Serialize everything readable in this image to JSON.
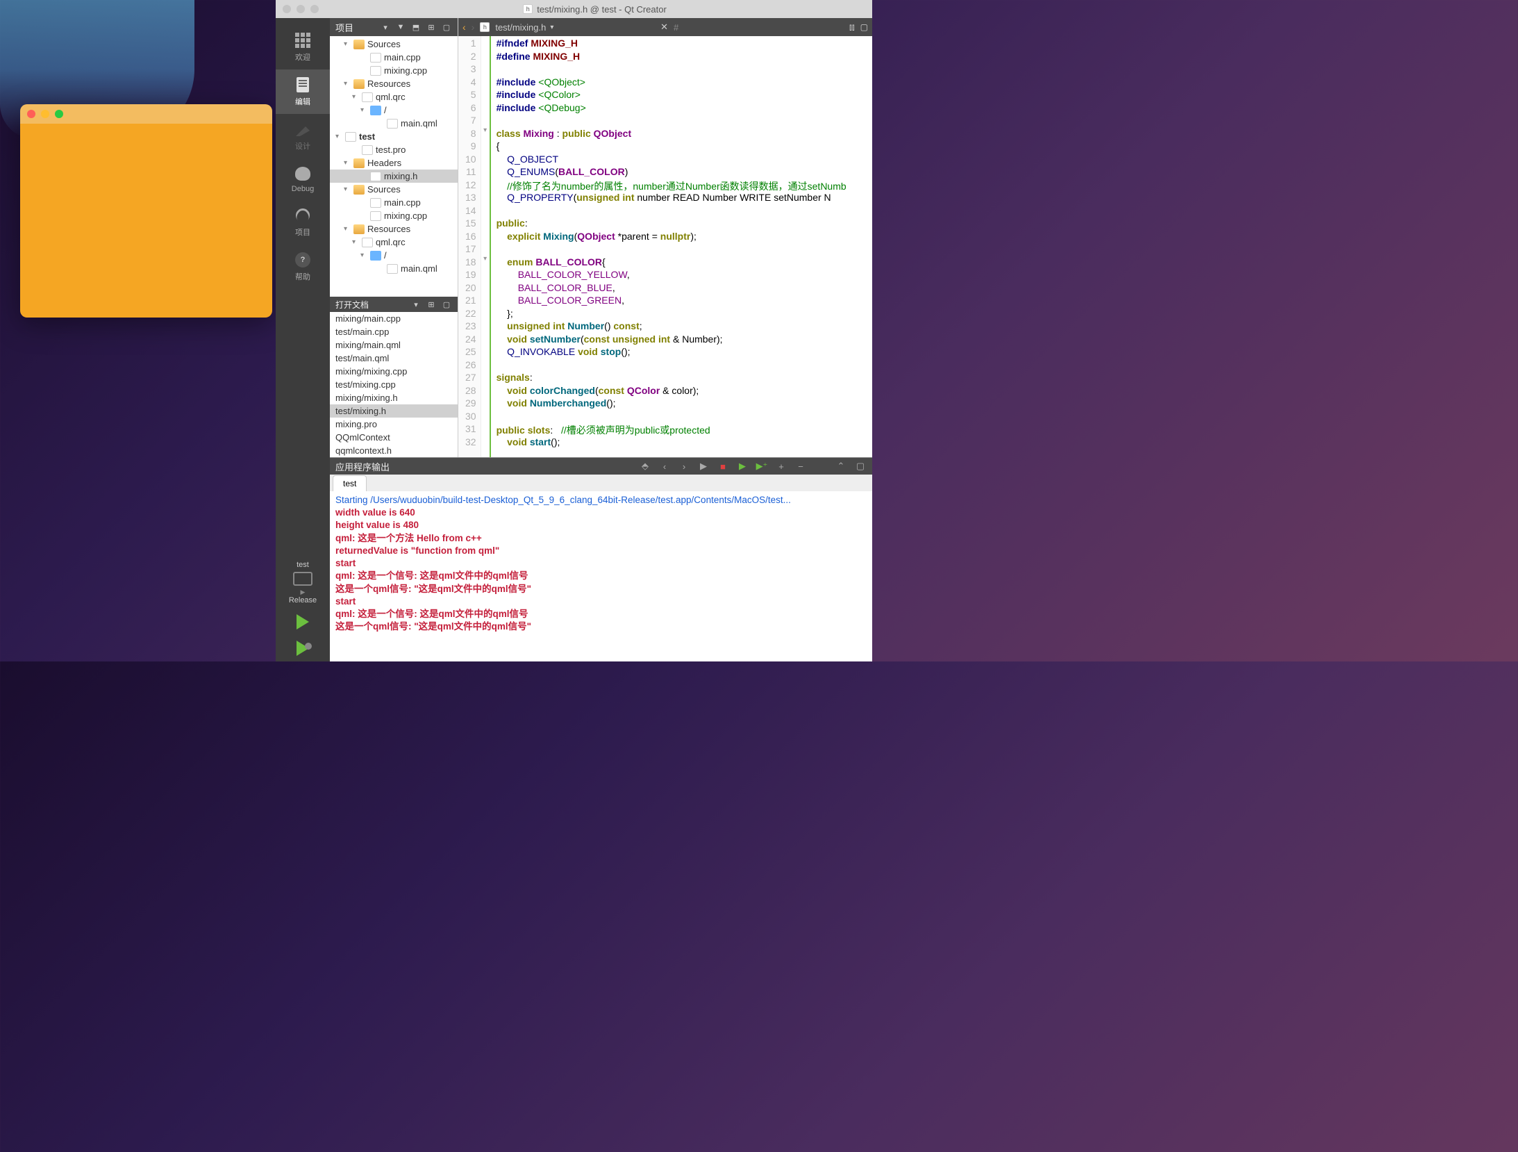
{
  "window_title": "test/mixing.h @ test - Qt Creator",
  "modebar": {
    "welcome": "欢迎",
    "edit": "编辑",
    "design": "设计",
    "debug": "Debug",
    "project": "项目",
    "help": "帮助",
    "kit_name": "test",
    "build_mode": "Release"
  },
  "project_panel": {
    "title": "项目",
    "tree": [
      {
        "indent": 1,
        "chev": "▾",
        "icon": "cpp-folder",
        "label": "Sources"
      },
      {
        "indent": 3,
        "icon": "cpp",
        "label": "main.cpp"
      },
      {
        "indent": 3,
        "icon": "cpp",
        "label": "mixing.cpp"
      },
      {
        "indent": 1,
        "chev": "▾",
        "icon": "folder",
        "label": "Resources"
      },
      {
        "indent": 2,
        "chev": "▾",
        "icon": "qrc",
        "label": "qml.qrc"
      },
      {
        "indent": 3,
        "chev": "▾",
        "icon": "blue",
        "label": "/"
      },
      {
        "indent": 5,
        "icon": "qml",
        "label": "main.qml"
      },
      {
        "indent": 0,
        "chev": "▾",
        "icon": "pro",
        "label": "test",
        "bold": true
      },
      {
        "indent": 2,
        "icon": "pro",
        "label": "test.pro"
      },
      {
        "indent": 1,
        "chev": "▾",
        "icon": "folder",
        "label": "Headers"
      },
      {
        "indent": 3,
        "icon": "h",
        "label": "mixing.h",
        "selected": true
      },
      {
        "indent": 1,
        "chev": "▾",
        "icon": "cpp-folder",
        "label": "Sources"
      },
      {
        "indent": 3,
        "icon": "cpp",
        "label": "main.cpp"
      },
      {
        "indent": 3,
        "icon": "cpp",
        "label": "mixing.cpp"
      },
      {
        "indent": 1,
        "chev": "▾",
        "icon": "folder",
        "label": "Resources"
      },
      {
        "indent": 2,
        "chev": "▾",
        "icon": "qrc",
        "label": "qml.qrc"
      },
      {
        "indent": 3,
        "chev": "▾",
        "icon": "blue",
        "label": "/"
      },
      {
        "indent": 5,
        "icon": "qml",
        "label": "main.qml"
      }
    ]
  },
  "open_docs": {
    "title": "打开文档",
    "items": [
      "mixing/main.cpp",
      "test/main.cpp",
      "mixing/main.qml",
      "test/main.qml",
      "mixing/mixing.cpp",
      "test/mixing.cpp",
      "mixing/mixing.h",
      "test/mixing.h",
      "mixing.pro",
      "QQmlContext",
      "qqmlcontext.h"
    ],
    "selected_index": 7
  },
  "editor": {
    "path": "test/mixing.h",
    "hash": "#",
    "lines": [
      {
        "n": 1,
        "html": "<span class='kw-pp'>#ifndef</span> <span class='kw-ident'>MIXING_H</span>"
      },
      {
        "n": 2,
        "html": "<span class='kw-pp'>#define</span> <span class='kw-ident'>MIXING_H</span>"
      },
      {
        "n": 3,
        "html": ""
      },
      {
        "n": 4,
        "html": "<span class='kw-pp'>#include</span> <span class='kw-inc'>&lt;QObject&gt;</span>"
      },
      {
        "n": 5,
        "html": "<span class='kw-pp'>#include</span> <span class='kw-inc'>&lt;QColor&gt;</span>"
      },
      {
        "n": 6,
        "html": "<span class='kw-pp'>#include</span> <span class='kw-inc'>&lt;QDebug&gt;</span>"
      },
      {
        "n": 7,
        "html": ""
      },
      {
        "n": 8,
        "fold": "▾",
        "html": "<span class='kw-class'>class</span> <span class='kw-type'>Mixing</span> : <span class='kw-keyword'>public</span> <span class='kw-type'>QObject</span>"
      },
      {
        "n": 9,
        "html": "{"
      },
      {
        "n": 10,
        "html": "    <span class='kw-macro'>Q_OBJECT</span>"
      },
      {
        "n": 11,
        "html": "    <span class='kw-macro'>Q_ENUMS</span>(<span class='kw-type'>BALL_COLOR</span>)"
      },
      {
        "n": 12,
        "html": "    <span class='kw-comment'>//修饰了名为number的属性，number通过Number函数读得数据，通过setNumb</span>"
      },
      {
        "n": 13,
        "html": "    <span class='kw-macro'>Q_PROPERTY</span>(<span class='kw-keyword'>unsigned</span> <span class='kw-keyword'>int</span> number READ Number WRITE setNumber N"
      },
      {
        "n": 14,
        "html": ""
      },
      {
        "n": 15,
        "html": "<span class='kw-keyword'>public</span>:"
      },
      {
        "n": 16,
        "html": "    <span class='kw-keyword'>explicit</span> <span class='kw-func'>Mixing</span>(<span class='kw-type'>QObject</span> *parent = <span class='kw-keyword'>nullptr</span>);"
      },
      {
        "n": 17,
        "html": ""
      },
      {
        "n": 18,
        "fold": "▾",
        "html": "    <span class='kw-keyword'>enum</span> <span class='kw-type'>BALL_COLOR</span>{"
      },
      {
        "n": 19,
        "html": "        <span class='kw-enum'>BALL_COLOR_YELLOW</span>,"
      },
      {
        "n": 20,
        "html": "        <span class='kw-enum'>BALL_COLOR_BLUE</span>,"
      },
      {
        "n": 21,
        "html": "        <span class='kw-enum'>BALL_COLOR_GREEN</span>,"
      },
      {
        "n": 22,
        "html": "    };"
      },
      {
        "n": 23,
        "html": "    <span class='kw-keyword'>unsigned</span> <span class='kw-keyword'>int</span> <span class='kw-func'>Number</span>() <span class='kw-keyword'>const</span>;"
      },
      {
        "n": 24,
        "html": "    <span class='kw-keyword'>void</span> <span class='kw-func'>setNumber</span>(<span class='kw-keyword'>const</span> <span class='kw-keyword'>unsigned</span> <span class='kw-keyword'>int</span> &amp; Number);"
      },
      {
        "n": 25,
        "html": "    <span class='kw-macro'>Q_INVOKABLE</span> <span class='kw-keyword'>void</span> <span class='kw-func'>stop</span>();"
      },
      {
        "n": 26,
        "html": ""
      },
      {
        "n": 27,
        "html": "<span class='kw-keyword'>signals</span>:"
      },
      {
        "n": 28,
        "html": "    <span class='kw-keyword'>void</span> <span class='kw-func'>colorChanged</span>(<span class='kw-keyword'>const</span> <span class='kw-type'>QColor</span> &amp; color);"
      },
      {
        "n": 29,
        "html": "    <span class='kw-keyword'>void</span> <span class='kw-func'>Numberchanged</span>();"
      },
      {
        "n": 30,
        "html": ""
      },
      {
        "n": 31,
        "html": "<span class='kw-keyword'>public</span> <span class='kw-keyword'>slots</span>:   <span class='kw-comment'>//槽必须被声明为public或protected</span>"
      },
      {
        "n": 32,
        "html": "    <span class='kw-keyword'>void</span> <span class='kw-func'>start</span>();"
      }
    ]
  },
  "output": {
    "title": "应用程序输出",
    "tab": "test",
    "lines": [
      {
        "cls": "out-blue",
        "text": "Starting /Users/wuduobin/build-test-Desktop_Qt_5_9_6_clang_64bit-Release/test.app/Contents/MacOS/test..."
      },
      {
        "cls": "out-red",
        "text": "width value is  640"
      },
      {
        "cls": "out-red",
        "text": "height value is  480"
      },
      {
        "cls": "out-red",
        "text": "qml: 这是一个方法 Hello from c++"
      },
      {
        "cls": "out-red",
        "text": "returnedValue is  \"function from qml\""
      },
      {
        "cls": "out-red",
        "text": "start"
      },
      {
        "cls": "out-red",
        "text": "qml: 这是一个信号:  这是qml文件中的qml信号"
      },
      {
        "cls": "out-red",
        "text": "这是一个qml信号:  \"这是qml文件中的qml信号\""
      },
      {
        "cls": "out-red",
        "text": "start"
      },
      {
        "cls": "out-red",
        "text": "qml: 这是一个信号:  这是qml文件中的qml信号"
      },
      {
        "cls": "out-red",
        "text": "这是一个qml信号:  \"这是qml文件中的qml信号\""
      }
    ]
  }
}
